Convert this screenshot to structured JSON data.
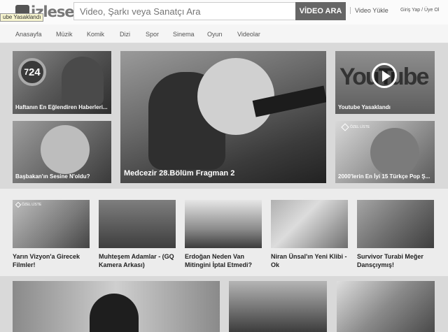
{
  "header": {
    "search_placeholder": "Video, Şarkı veya Sanatçı Ara",
    "search_button": "VİDEO ARA",
    "upload_link": "Video Yükle",
    "login_link": "Giriş Yap / Üye Ol",
    "tooltip": "ube Yasaklandı"
  },
  "nav": {
    "items": [
      "Anasayfa",
      "Müzik",
      "Komik",
      "Dizi",
      "Spor",
      "Sinema",
      "Oyun",
      "Videolar"
    ]
  },
  "featured": {
    "tiles": [
      {
        "caption": "Haftanın En Eğlendiren Haberleri..."
      },
      {
        "caption": "Medcezir 28.Bölüm Fragman 2"
      },
      {
        "caption": "Youtube Yasaklandı"
      },
      {
        "caption": "Başbakan'ın Sesine N'oldu?"
      },
      {
        "caption": "2000'lerin En İyi 15 Türkçe Pop Ş..."
      }
    ],
    "badge_724": "24",
    "badge_724_top": "7",
    "youtube_logo": "YouTube",
    "special_list": "ÖZEL LİSTE"
  },
  "thumbs": {
    "titles": [
      "Yarın Vizyon'a Girecek Filmler!",
      "Muhteşem Adamlar - (GQ Kamera Arkası)",
      "Erdoğan Neden Van Mitingini İptal Etmedi?",
      "Niran Ünsal'ın Yeni Klibi - Ok",
      "Survivor Turabi Meğer Dansçıymış!"
    ],
    "special_list": "ÖZEL LİSTE"
  }
}
